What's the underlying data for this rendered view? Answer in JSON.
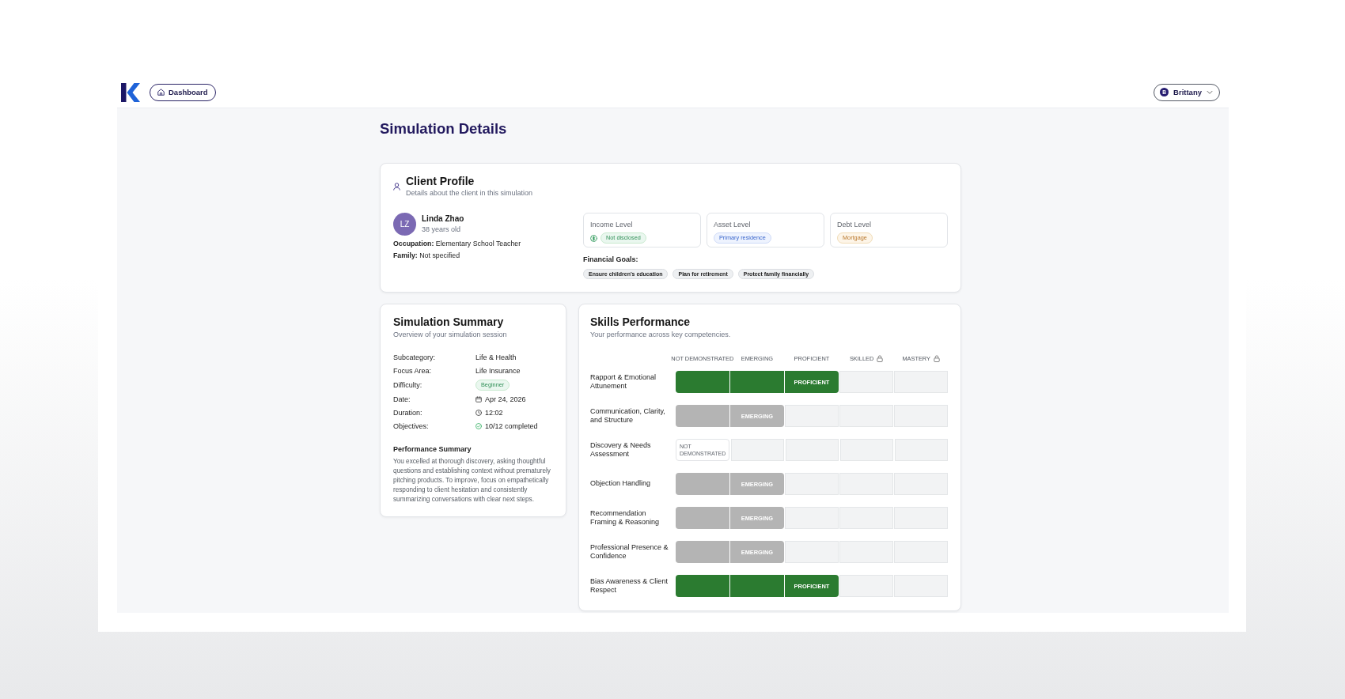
{
  "header": {
    "nav_button": {
      "label": "Dashboard"
    },
    "user_menu": {
      "initial": "B",
      "name": "Brittany"
    }
  },
  "page_title": "Simulation Details",
  "client_profile": {
    "title": "Client Profile",
    "subtitle": "Details about the client in this simulation",
    "client": {
      "initials": "LZ",
      "name": "Linda Zhao",
      "age": "38 years old"
    },
    "facts": [
      "**Occupation:** Elementary School Teacher",
      "**Family:** Not specified"
    ],
    "financials": [
      {
        "kind": "income",
        "label": "Income Level",
        "value": "Not disclosed"
      },
      {
        "kind": "asset",
        "label": "Asset Level",
        "value": "Primary residence"
      },
      {
        "kind": "debt",
        "label": "Debt Level",
        "value": "Mortgage"
      }
    ],
    "goals_label": "Financial Goals:",
    "goals": [
      "Ensure children's education",
      "Plan for retirement",
      "Protect family financially"
    ]
  },
  "simulation_summary": {
    "title": "Simulation Summary",
    "subtitle": "Overview of your simulation session",
    "details": [
      {
        "kind": "text",
        "label": "Subcategory:",
        "value": "Life & Health"
      },
      {
        "kind": "text",
        "label": "Focus Area:",
        "value": "Life Insurance"
      },
      {
        "kind": "tag",
        "label": "Difficulty:",
        "value": "Beginner"
      },
      {
        "kind": "date",
        "label": "Date:",
        "value": "Apr 24, 2026"
      },
      {
        "kind": "duration",
        "label": "Duration:",
        "value": "12:02"
      },
      {
        "kind": "objectives",
        "label": "Objectives:",
        "value": "10/12 completed"
      }
    ],
    "performance_summary": {
      "heading": "Performance Summary",
      "text": "You excelled at thorough discovery, asking thoughtful questions and establishing context without prematurely pitching products. To improve, focus on empathetically responding to client hesitation and consistently summarizing conversations with clear next steps."
    }
  },
  "skills_performance": {
    "title": "Skills Performance",
    "subtitle": "Your performance across key competencies.",
    "levels": [
      {
        "label": "NOT DEMONSTRATED",
        "locked": false
      },
      {
        "label": "EMERGING",
        "locked": false
      },
      {
        "label": "PROFICIENT",
        "locked": false
      },
      {
        "label": "SKILLED",
        "locked": true
      },
      {
        "label": "MASTERY",
        "locked": true
      }
    ],
    "skills": [
      {
        "name": "Rapport & Emotional Attunement",
        "kind": "met",
        "cells": [
          {
            "kind": "filled"
          },
          {
            "kind": "filled"
          },
          {
            "kind": "current",
            "label": "PROFICIENT"
          },
          {
            "kind": "empty"
          },
          {
            "kind": "empty"
          }
        ]
      },
      {
        "name": "Communication, Clarity, and Structure",
        "kind": "developing",
        "cells": [
          {
            "kind": "filled"
          },
          {
            "kind": "current",
            "label": "EMERGING"
          },
          {
            "kind": "empty"
          },
          {
            "kind": "empty"
          },
          {
            "kind": "empty"
          }
        ]
      },
      {
        "name": "Discovery & Needs Assessment",
        "kind": "unmet",
        "cells": [
          {
            "kind": "current",
            "label": "NOT DEMONSTRATED"
          },
          {
            "kind": "empty"
          },
          {
            "kind": "empty"
          },
          {
            "kind": "empty"
          },
          {
            "kind": "empty"
          }
        ]
      },
      {
        "name": "Objection Handling",
        "kind": "developing",
        "cells": [
          {
            "kind": "filled"
          },
          {
            "kind": "current",
            "label": "EMERGING"
          },
          {
            "kind": "empty"
          },
          {
            "kind": "empty"
          },
          {
            "kind": "empty"
          }
        ]
      },
      {
        "name": "Recommendation Framing & Reasoning",
        "kind": "developing",
        "cells": [
          {
            "kind": "filled"
          },
          {
            "kind": "current",
            "label": "EMERGING"
          },
          {
            "kind": "empty"
          },
          {
            "kind": "empty"
          },
          {
            "kind": "empty"
          }
        ]
      },
      {
        "name": "Professional Presence & Confidence",
        "kind": "developing",
        "cells": [
          {
            "kind": "filled"
          },
          {
            "kind": "current",
            "label": "EMERGING"
          },
          {
            "kind": "empty"
          },
          {
            "kind": "empty"
          },
          {
            "kind": "empty"
          }
        ]
      },
      {
        "name": "Bias Awareness & Client Respect",
        "kind": "met",
        "cells": [
          {
            "kind": "filled"
          },
          {
            "kind": "filled"
          },
          {
            "kind": "current",
            "label": "PROFICIENT"
          },
          {
            "kind": "empty"
          },
          {
            "kind": "empty"
          }
        ]
      }
    ]
  }
}
